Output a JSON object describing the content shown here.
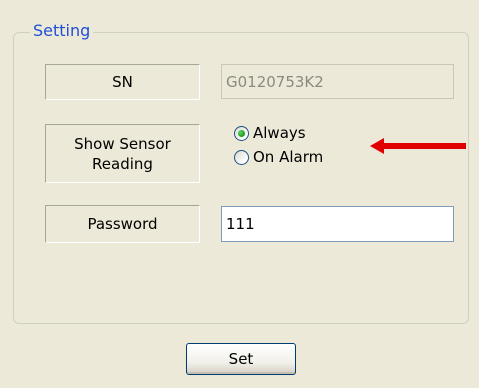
{
  "group": {
    "title": "Setting"
  },
  "fields": {
    "sn_label": "SN",
    "sn_value": "G0120753K2",
    "show_label_line1": "Show Sensor",
    "show_label_line2": "Reading",
    "password_label": "Password",
    "password_value": "111"
  },
  "radio": {
    "options": [
      {
        "label": "Always",
        "selected": true
      },
      {
        "label": "On Alarm",
        "selected": false
      }
    ]
  },
  "buttons": {
    "set_label": "Set"
  },
  "colors": {
    "background": "#ece9d8",
    "group_title": "#1f4fd6",
    "arrow": "#e00000",
    "radio_selected": "#21a121"
  },
  "annotation": {
    "arrow_icon": "red-arrow-left"
  }
}
